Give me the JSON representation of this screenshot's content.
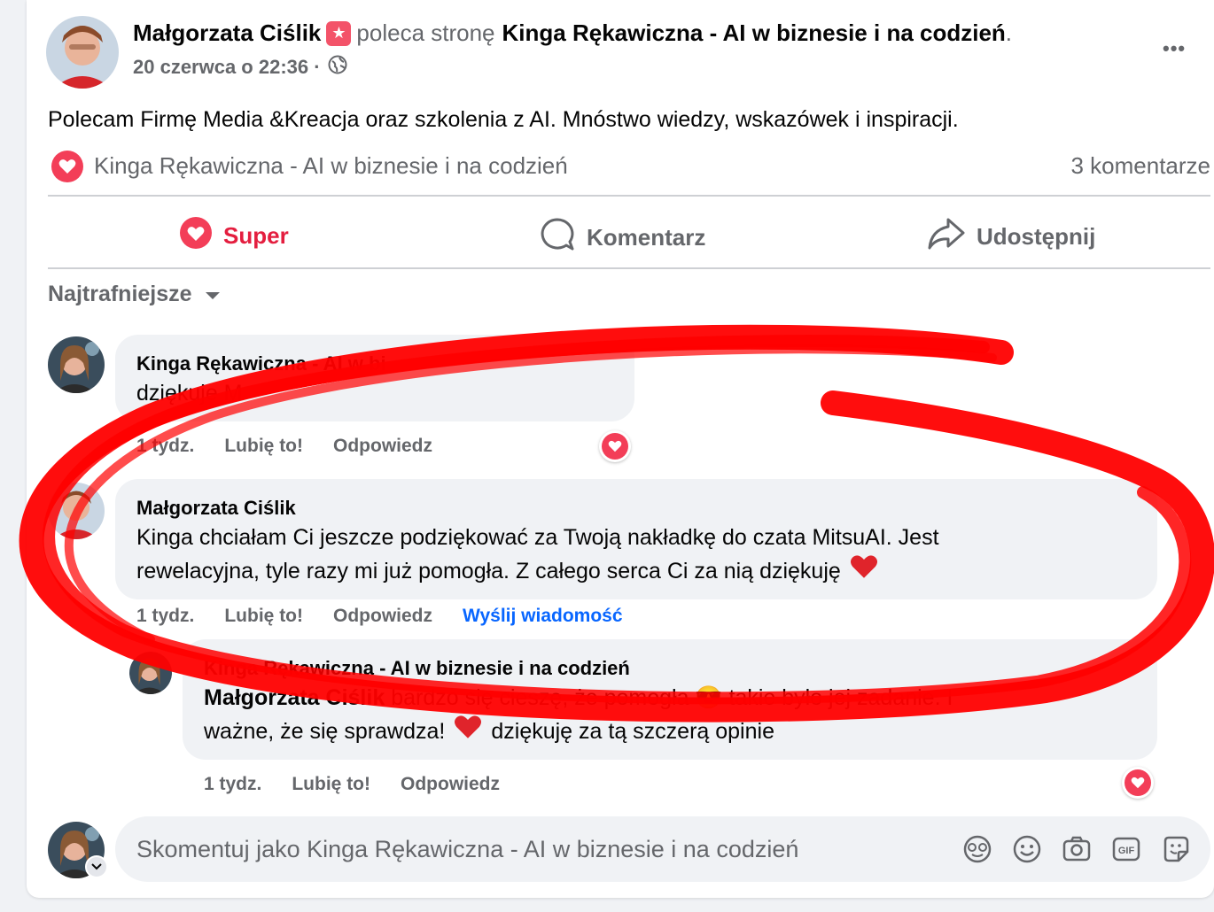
{
  "post": {
    "author": "Małgorzata Ciślik",
    "action": "poleca stronę",
    "page": "Kinga Rękawiczna - AI w biznesie i na codzień",
    "page_suffix": ".",
    "date": "20 czerwca o 22:36 ·",
    "body": "Polecam Firmę Media &Kreacja oraz szkolenia z AI. Mnóstwo wiedzy, wskazówek i inspiracji.",
    "reactions_label": "Kinga Rękawiczna - AI w biznesie i na codzień",
    "comments_count": "3 komentarze",
    "menu_icon": "•••"
  },
  "actions": {
    "like": "Super",
    "comment": "Komentarz",
    "share": "Udostępnij"
  },
  "sort": {
    "label": "Najtrafniejsze"
  },
  "comments": [
    {
      "name": "Kinga Rękawiczna - AI w bi",
      "text": "dziękuje M",
      "time": "1 tydz.",
      "like": "Lubię to!",
      "reply": "Odpowiedz"
    },
    {
      "name": "Małgorzata Ciślik",
      "text_line1": "Kinga chciałam Ci jeszcze podziękować za Twoją nakładkę do czata MitsuAI. Jest",
      "text_line2": "rewelacyjna, tyle razy mi już pomogła. Z całego serca Ci za nią dziękuję",
      "time": "1 tydz.",
      "like": "Lubię to!",
      "reply": "Odpowiedz",
      "message": "Wyślij wiadomość"
    },
    {
      "name": "Kinga Rękawiczna - AI w biznesie i na codzień",
      "mention": "Małgorzata Ciślik",
      "text_line1": "bardzo się cieszę, że pomogła 😎 takie było jej zadanie. I",
      "text_line2": "ważne, że się sprawdza!",
      "text_line2b": "dziękuję za tą szczerą opinie",
      "time": "1 tydz.",
      "like": "Lubię to!",
      "reply": "Odpowiedz"
    }
  ],
  "composer": {
    "placeholder": "Skomentuj jako Kinga Rękawiczna - AI w biznesie i na codzień"
  },
  "colors": {
    "accent_red": "#e41e3f",
    "link_blue": "#0866ff",
    "muted": "#65676b",
    "annotation_red": "#ff0000"
  }
}
